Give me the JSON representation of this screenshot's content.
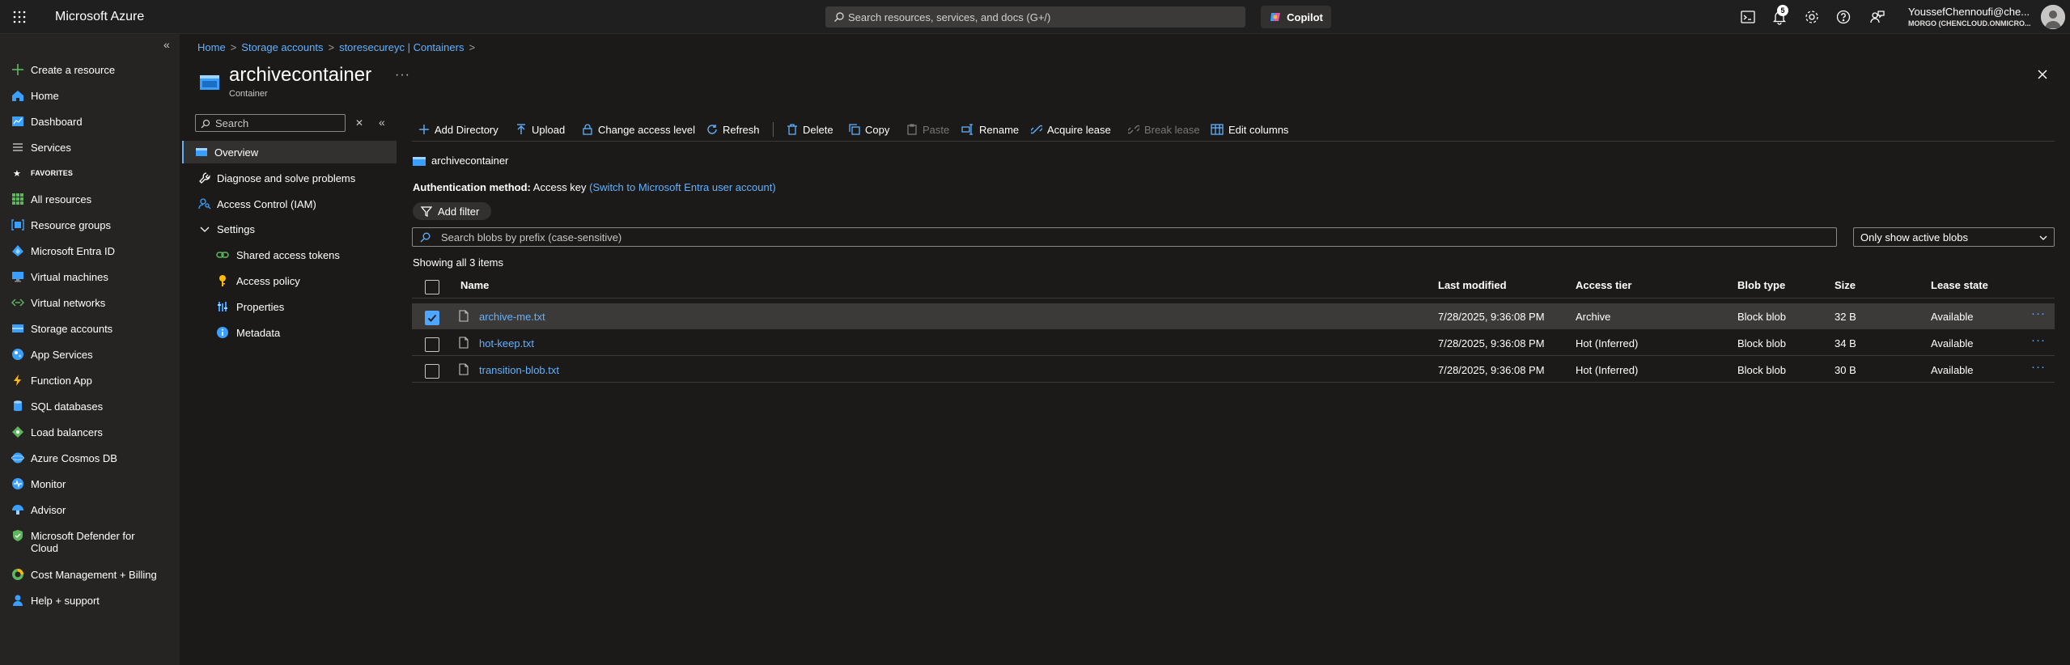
{
  "topbar": {
    "brand": "Microsoft Azure",
    "search_placeholder": "Search resources, services, and docs (G+/)",
    "copilot_label": "Copilot",
    "notification_count": "5",
    "account_name": "YoussefChennoufi@che...",
    "account_directory": "MORGO (CHENCLOUD.ONMICRO..."
  },
  "leftnav": {
    "favorites_label": "FAVORITES",
    "items": [
      {
        "label": "Create a resource",
        "icon": "plus-icon"
      },
      {
        "label": "Home",
        "icon": "home-icon"
      },
      {
        "label": "Dashboard",
        "icon": "dashboard-icon"
      },
      {
        "label": "Services",
        "icon": "services-icon"
      },
      {
        "label": "All resources",
        "icon": "all-resources-icon"
      },
      {
        "label": "Resource groups",
        "icon": "resource-groups-icon"
      },
      {
        "label": "Microsoft Entra ID",
        "icon": "entra-id-icon"
      },
      {
        "label": "Virtual machines",
        "icon": "virtual-machines-icon"
      },
      {
        "label": "Virtual networks",
        "icon": "virtual-networks-icon"
      },
      {
        "label": "Storage accounts",
        "icon": "storage-accounts-icon"
      },
      {
        "label": "App Services",
        "icon": "app-services-icon"
      },
      {
        "label": "Function App",
        "icon": "function-app-icon"
      },
      {
        "label": "SQL databases",
        "icon": "sql-databases-icon"
      },
      {
        "label": "Load balancers",
        "icon": "load-balancers-icon"
      },
      {
        "label": "Azure Cosmos DB",
        "icon": "cosmos-db-icon"
      },
      {
        "label": "Monitor",
        "icon": "monitor-icon"
      },
      {
        "label": "Advisor",
        "icon": "advisor-icon"
      },
      {
        "label": "Microsoft Defender for",
        "label2": "Cloud",
        "icon": "defender-icon"
      },
      {
        "label": "Cost Management + Billing",
        "icon": "cost-management-icon"
      },
      {
        "label": "Help + support",
        "icon": "help-support-icon"
      }
    ]
  },
  "breadcrumb": [
    "Home",
    "Storage accounts",
    "storesecureyc | Containers"
  ],
  "page": {
    "title": "archivecontainer",
    "subtitle": "Container"
  },
  "resource_menu": {
    "search_placeholder": "Search",
    "items": [
      {
        "label": "Overview"
      },
      {
        "label": "Diagnose and solve problems"
      },
      {
        "label": "Access Control (IAM)"
      },
      {
        "label": "Settings"
      },
      {
        "label": "Shared access tokens"
      },
      {
        "label": "Access policy"
      },
      {
        "label": "Properties"
      },
      {
        "label": "Metadata"
      }
    ]
  },
  "toolbar": {
    "add_directory": "Add Directory",
    "upload": "Upload",
    "change_access": "Change access level",
    "refresh": "Refresh",
    "delete": "Delete",
    "copy": "Copy",
    "paste": "Paste",
    "rename": "Rename",
    "acquire_lease": "Acquire lease",
    "break_lease": "Break lease",
    "edit_columns": "Edit columns"
  },
  "content": {
    "container_name": "archivecontainer",
    "auth_label": "Authentication method:",
    "auth_value": "Access key",
    "auth_switch": "(Switch to Microsoft Entra user account)",
    "add_filter": "Add filter",
    "blob_search_placeholder": "Search blobs by prefix (case-sensitive)",
    "active_filter": "Only show active blobs",
    "showing": "Showing all 3 items"
  },
  "table": {
    "columns": [
      "Name",
      "Last modified",
      "Access tier",
      "Blob type",
      "Size",
      "Lease state"
    ],
    "rows": [
      {
        "name": "archive-me.txt",
        "modified": "7/28/2025, 9:36:08 PM",
        "tier": "Archive",
        "type": "Block blob",
        "size": "32 B",
        "lease": "Available",
        "selected": true
      },
      {
        "name": "hot-keep.txt",
        "modified": "7/28/2025, 9:36:08 PM",
        "tier": "Hot (Inferred)",
        "type": "Block blob",
        "size": "34 B",
        "lease": "Available",
        "selected": false
      },
      {
        "name": "transition-blob.txt",
        "modified": "7/28/2025, 9:36:08 PM",
        "tier": "Hot (Inferred)",
        "type": "Block blob",
        "size": "30 B",
        "lease": "Available",
        "selected": false
      }
    ]
  },
  "colors": {
    "accent": "#62b1ff",
    "background": "#1b1a19",
    "nav_background": "#252423",
    "checkbox_checked": "#4fa6ff"
  }
}
